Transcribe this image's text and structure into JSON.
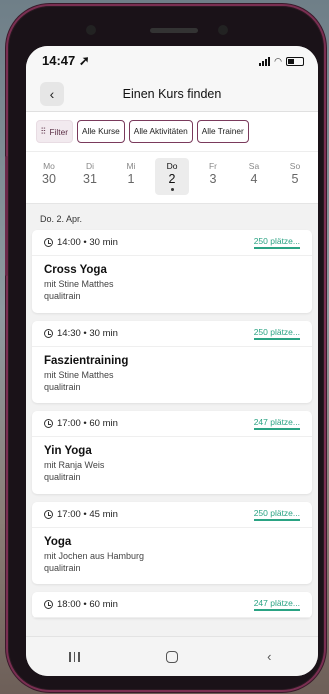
{
  "status": {
    "time": "14:47 ➚"
  },
  "nav": {
    "title": "Einen Kurs finden",
    "back_icon": "chevron-left-icon"
  },
  "filters": {
    "filter_label": "Filter",
    "chips": [
      "Alle Kurse",
      "Alle Aktivitäten",
      "Alle Trainer"
    ]
  },
  "days": [
    {
      "dow": "Mo",
      "num": "30"
    },
    {
      "dow": "Di",
      "num": "31"
    },
    {
      "dow": "Mi",
      "num": "1"
    },
    {
      "dow": "Do",
      "num": "2",
      "selected": true
    },
    {
      "dow": "Fr",
      "num": "3"
    },
    {
      "dow": "Sa",
      "num": "4"
    },
    {
      "dow": "So",
      "num": "5"
    }
  ],
  "section_date": "Do. 2. Apr.",
  "classes": [
    {
      "time": "14:00 • 30 min",
      "spots": "250 plätze...",
      "name": "Cross Yoga",
      "trainer": "mit Stine Matthes",
      "provider": "qualitrain"
    },
    {
      "time": "14:30 • 30 min",
      "spots": "250 plätze...",
      "name": "Faszientraining",
      "trainer": "mit Stine Matthes",
      "provider": "qualitrain"
    },
    {
      "time": "17:00 • 60 min",
      "spots": "247 plätze...",
      "name": "Yin Yoga",
      "trainer": "mit Ranja Weis",
      "provider": "qualitrain"
    },
    {
      "time": "17:00 • 45 min",
      "spots": "250 plätze...",
      "name": "Yoga",
      "trainer": "mit Jochen aus Hamburg",
      "provider": "qualitrain"
    },
    {
      "time": "18:00 • 60 min",
      "spots": "247 plätze..."
    }
  ],
  "colors": {
    "accent": "#2aa383",
    "chip_border": "#7a3a5c",
    "phone_frame": "#7a2f52"
  }
}
